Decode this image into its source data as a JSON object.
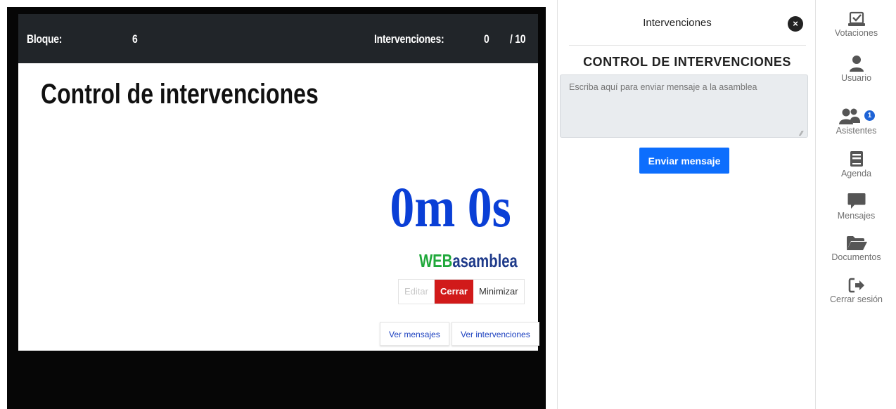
{
  "stage": {
    "bloque_label": "Bloque:",
    "bloque_value": "6",
    "intervenciones_label": "Intervenciones:",
    "intervenciones_value": "0",
    "intervenciones_total": "/ 10",
    "title": "Control de intervenciones",
    "timer": "0m 0s",
    "brand_web": "WEB",
    "brand_asm": "asamblea",
    "buttons": {
      "edit": "Editar",
      "close": "Cerrar",
      "minimize": "Minimizar"
    },
    "ver_mensajes": "Ver mensajes",
    "ver_intervenciones": "Ver intervenciones"
  },
  "side": {
    "title": "Intervenciones",
    "close_symbol": "×",
    "heading": "CONTROL DE INTERVENCIONES",
    "textarea_placeholder": "Escriba aquí para enviar mensaje a la asamblea",
    "send_button": "Enviar mensaje"
  },
  "nav": {
    "items": [
      {
        "icon": "vote-check-icon",
        "label": "Votaciones"
      },
      {
        "icon": "user-icon",
        "label": "Usuario"
      },
      {
        "icon": "users-icon",
        "label": "Asistentes",
        "badge": "1"
      },
      {
        "icon": "book-icon",
        "label": "Agenda"
      },
      {
        "icon": "message-icon",
        "label": "Mensajes"
      },
      {
        "icon": "folder-open-icon",
        "label": "Documentos"
      },
      {
        "icon": "sign-out-icon",
        "label": "Cerrar sesión"
      }
    ]
  },
  "colors": {
    "timer": "#0a3fd6",
    "brand_web": "#1fa83a",
    "brand_asm": "#1e3a8a",
    "close_button": "#d11a1a",
    "send_button": "#0d6efd",
    "badge": "#1e63d6"
  }
}
